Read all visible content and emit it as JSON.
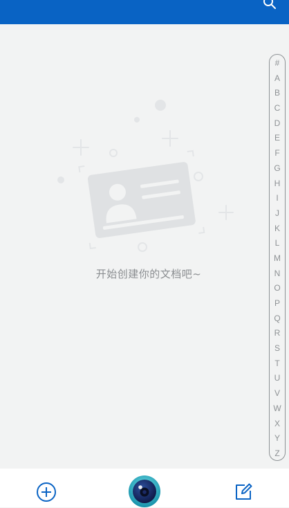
{
  "header": {
    "background": "#0963c4",
    "search_icon": "search-icon"
  },
  "empty_state": {
    "message": "开始创建你的文档吧~",
    "illustration_icon": "id-card-icon"
  },
  "index_bar": {
    "letters": [
      "#",
      "A",
      "B",
      "C",
      "D",
      "E",
      "F",
      "G",
      "H",
      "I",
      "J",
      "K",
      "L",
      "M",
      "N",
      "O",
      "P",
      "Q",
      "R",
      "S",
      "T",
      "U",
      "V",
      "W",
      "X",
      "Y",
      "Z"
    ]
  },
  "bottom_bar": {
    "add_icon": "plus-circle-icon",
    "camera_icon": "camera-lens-icon",
    "edit_icon": "edit-icon",
    "accent": "#0963c4"
  }
}
